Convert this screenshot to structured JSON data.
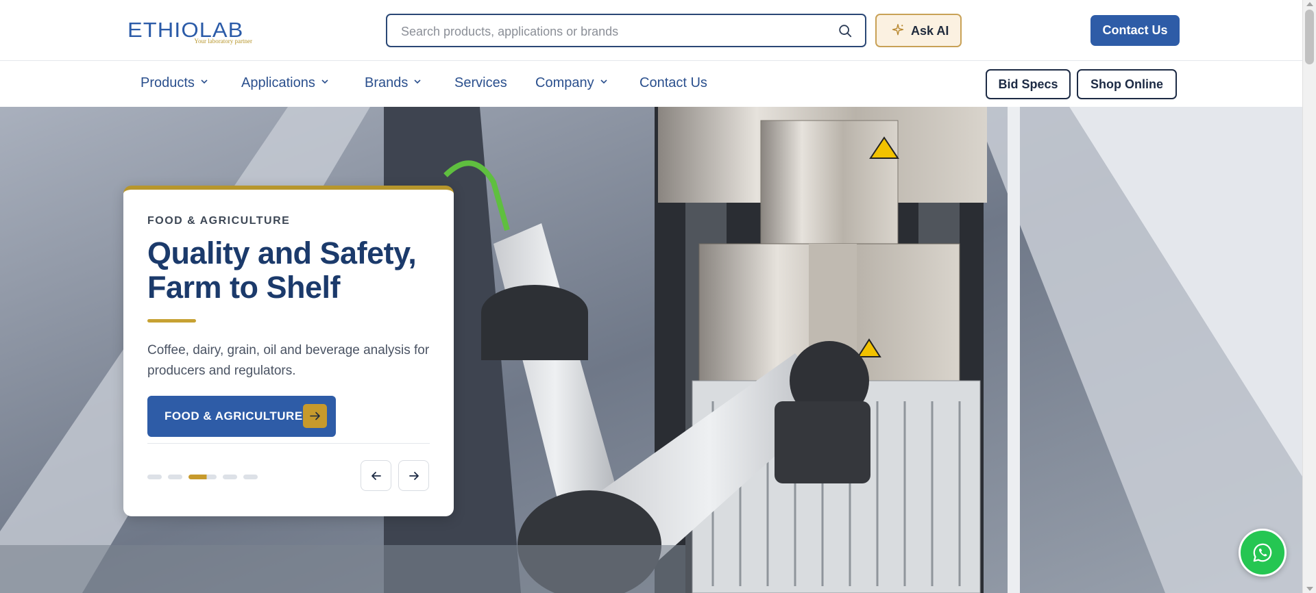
{
  "header": {
    "logo_text": "ETHIOLAB",
    "logo_tagline": "Your laboratory partner",
    "search_placeholder": "Search products, applications or brands",
    "ask_ai_label": "Ask AI",
    "contact_label": "Contact Us"
  },
  "nav": {
    "items": [
      {
        "label": "Products",
        "has_dropdown": true
      },
      {
        "label": "Applications",
        "has_dropdown": true
      },
      {
        "label": "Brands",
        "has_dropdown": true
      },
      {
        "label": "Services",
        "has_dropdown": false
      },
      {
        "label": "Company",
        "has_dropdown": true
      },
      {
        "label": "Contact Us",
        "has_dropdown": false
      }
    ],
    "bid_specs_label": "Bid Specs",
    "shop_online_label": "Shop Online"
  },
  "hero": {
    "eyebrow": "FOOD & AGRICULTURE",
    "title": "Quality and Safety, Farm to Shelf",
    "description": "Coffee, dairy, grain, oil and beverage analysis for producers and regulators.",
    "cta_label": "FOOD & AGRICULTURE",
    "slide_count": 5,
    "active_slide": 3
  },
  "icons": {
    "search": "search-icon",
    "ask_ai": "sparkle-icon",
    "chevron": "chevron-down-icon",
    "cta_arrow": "arrow-right-icon",
    "prev": "arrow-left-icon",
    "next": "arrow-right-icon",
    "whatsapp": "whatsapp-icon"
  },
  "colors": {
    "brand_blue": "#2e5ca7",
    "brand_gold": "#c79a2c",
    "whatsapp_green": "#25c652"
  }
}
